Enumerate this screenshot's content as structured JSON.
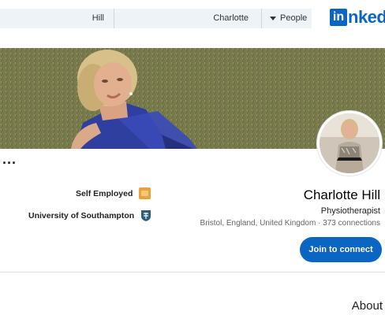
{
  "search": {
    "last_name": "Hill",
    "first_name": "Charlotte",
    "category": "People"
  },
  "logo": {
    "text": "nked",
    "box": "in"
  },
  "profile": {
    "name": "Charlotte Hill",
    "headline": "Physiotherapist",
    "location": "Bristol, England, United Kingdom · 373 connections",
    "current_company": "Self Employed",
    "education": "University of Southampton"
  },
  "actions": {
    "more": "...",
    "join": "Join to connect"
  },
  "sections": {
    "about": "About"
  },
  "colors": {
    "brand": "#0a66c2",
    "search_bg": "#eef3f8",
    "company_icon": "#e7a33e"
  },
  "icons": {
    "company": "company-logo-icon",
    "education": "school-shield-icon",
    "caret": "caret-down-icon"
  }
}
